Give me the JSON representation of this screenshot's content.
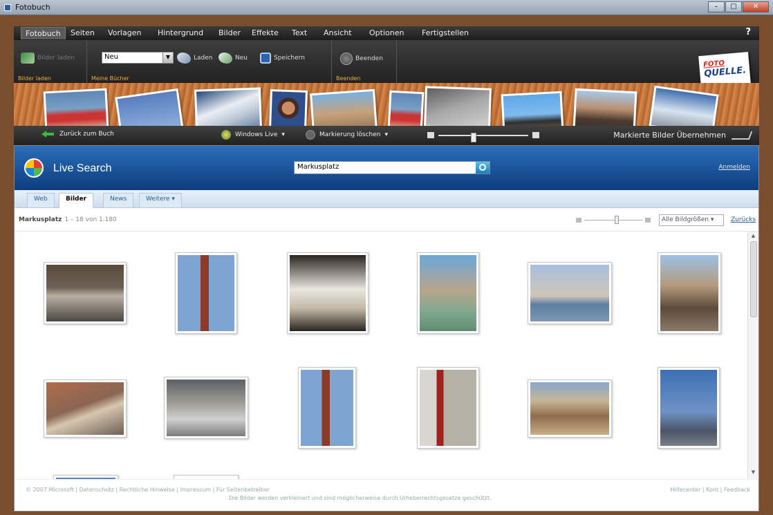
{
  "window": {
    "title": "Fotobuch",
    "buttons": [
      "–",
      "□",
      "✕"
    ]
  },
  "menu": {
    "items": [
      "Fotobuch",
      "Seiten",
      "Vorlagen",
      "Hintergrund",
      "Bilder",
      "Effekte",
      "Text",
      "Ansicht",
      "Optionen",
      "Fertigstellen"
    ],
    "active_index": 0,
    "help": "?"
  },
  "ribbon": {
    "groups": [
      {
        "caption": "Bilder laden",
        "buttons": [
          {
            "label": "Bilder laden",
            "icon": "photo-icon",
            "enabled": false
          }
        ]
      },
      {
        "caption": "Meine Bücher",
        "select_value": "Neu",
        "buttons": [
          {
            "label": "Laden",
            "icon": "open-icon"
          },
          {
            "label": "Neu",
            "icon": "new-icon"
          },
          {
            "label": "Speichern",
            "icon": "save-icon"
          }
        ]
      },
      {
        "caption": "Beenden",
        "buttons": [
          {
            "label": "Beenden",
            "icon": "quit-icon"
          }
        ]
      }
    ],
    "logo": {
      "line1": "FOTO",
      "line2": "QUELLE."
    }
  },
  "toolbar": {
    "back_label": "Zurück zum Buch",
    "source_label": "Windows Live",
    "clear_label": "Markierung löschen",
    "zoom_level": 0.36,
    "accept_label": "Markierte Bilder Übernehmen"
  },
  "live_search": {
    "title": "Live Search",
    "query": "Markusplatz",
    "login": "Anmelden",
    "tabs": [
      "Web",
      "Bilder",
      "News",
      "Weitere ▾"
    ],
    "active_tab": 1,
    "result_query": "Markusplatz",
    "result_count": "1 – 18 von 1.180",
    "size_filter": "Alle Bildgrößen ▾",
    "reset": "Zurücks"
  },
  "results": {
    "rows": [
      [
        "venice-arcade-photo",
        "campanile-photo",
        "piazza-silhouette-photo",
        "pigeons-square-photo",
        "lagoon-view-photo",
        "crowd-piazza-photo"
      ],
      [
        "rooftops-photo",
        "colonnade-photo",
        "campanile-blue-sky-photo",
        "campanile-red-photo",
        "cafe-tables-photo",
        "campanile-evening-photo"
      ]
    ]
  },
  "footer": {
    "left": "© 2007 Microsoft | Datenschutz | Rechtliche Hinweise | Impressum | Für Seitenbetreiber",
    "center": "Die Bilder werden verkleinert und sind möglicherweise durch Urheberrechtsgesetze geschützt.",
    "right": "Hilfecenter | Kont | Feedback"
  },
  "colors": {
    "ribbon_dark": "#222222",
    "accent_yellow": "#e8b13a",
    "live_blue": "#0d3d7e",
    "cork": "#c9793f"
  }
}
